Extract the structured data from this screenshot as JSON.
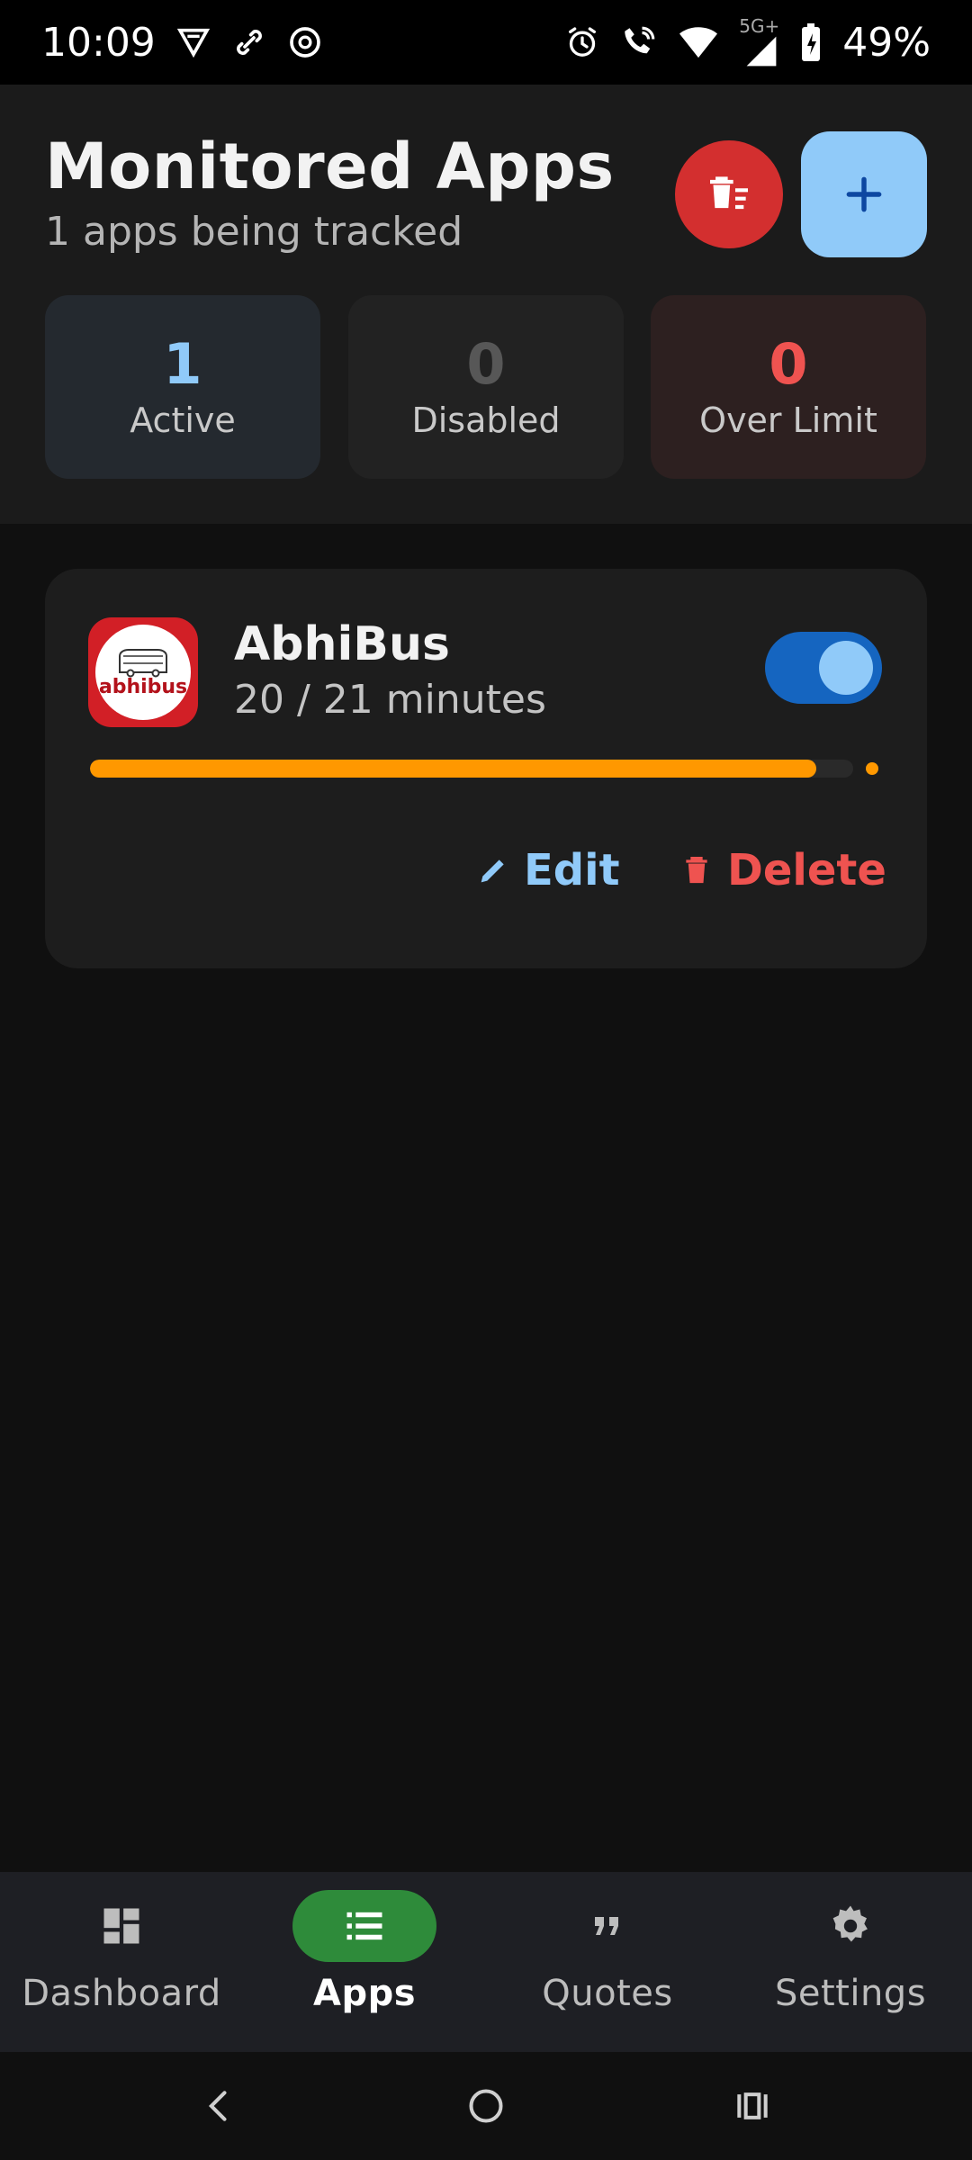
{
  "status_bar": {
    "time": "10:09",
    "battery": "49%",
    "network_label": "5G+",
    "left_icons": [
      "vpn-icon",
      "link-icon",
      "threads-icon"
    ],
    "right_icons": [
      "alarm-icon",
      "wifi-calling-icon",
      "wifi-icon",
      "signal-icon",
      "battery-charging-icon"
    ]
  },
  "header": {
    "title": "Monitored Apps",
    "subtitle": "1 apps being tracked",
    "delete_all_icon": "delete-sweep-icon",
    "add_icon": "plus-icon"
  },
  "stats": [
    {
      "value": "1",
      "label": "Active",
      "color": "#90caf9"
    },
    {
      "value": "0",
      "label": "Disabled",
      "color": "#575757"
    },
    {
      "value": "0",
      "label": "Over Limit",
      "color": "#ef5350"
    }
  ],
  "apps": [
    {
      "name": "AbhiBus",
      "icon_text": "abhibus",
      "usage": "20 / 21 minutes",
      "used_minutes": 20,
      "limit_minutes": 21,
      "progress_fraction": 0.952,
      "enabled": true,
      "edit_label": "Edit",
      "delete_label": "Delete"
    }
  ],
  "bottom_nav": [
    {
      "label": "Dashboard",
      "icon": "dashboard-icon",
      "active": false
    },
    {
      "label": "Apps",
      "icon": "list-icon",
      "active": true
    },
    {
      "label": "Quotes",
      "icon": "quote-icon",
      "active": false
    },
    {
      "label": "Settings",
      "icon": "gear-icon",
      "active": false
    }
  ],
  "colors": {
    "accent_blue": "#90caf9",
    "danger_red": "#d32f2f",
    "progress_orange": "#ff9800",
    "active_nav_green": "#2e8b3a"
  }
}
